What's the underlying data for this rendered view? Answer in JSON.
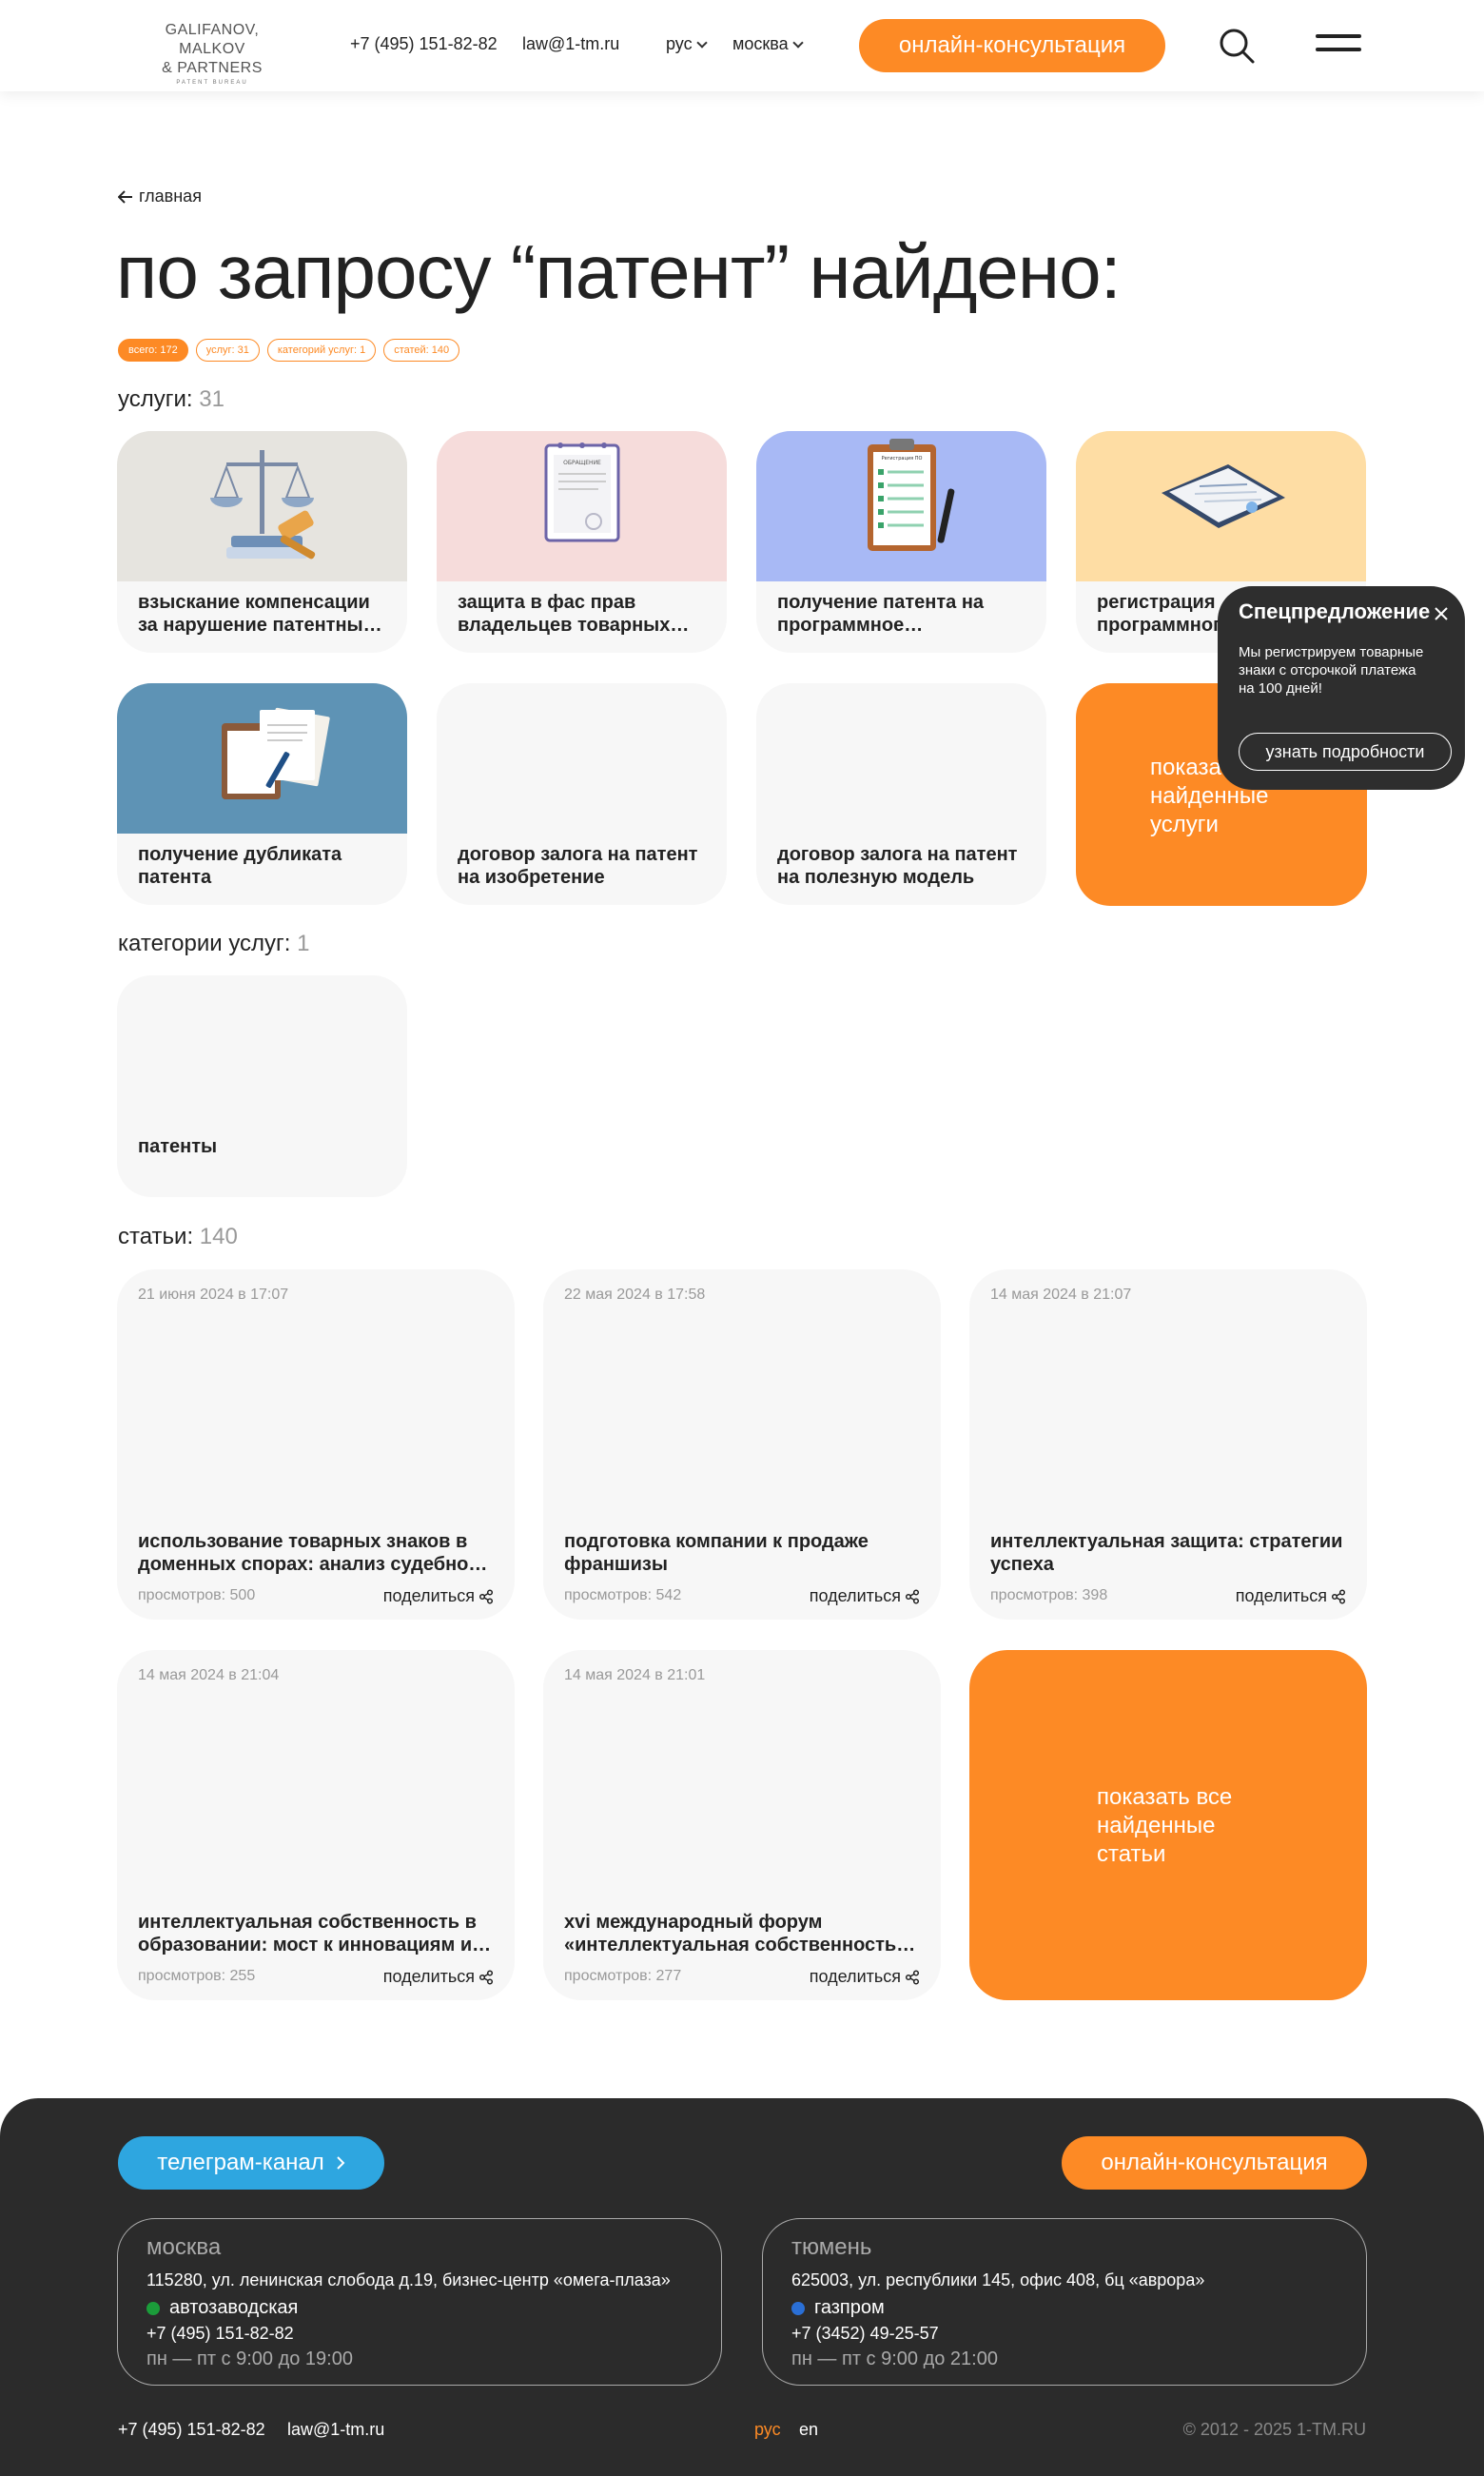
{
  "header": {
    "logo": {
      "line1": "GALIFANOV, MALKOV",
      "line2": "& PARTNERS",
      "line3": "PATENT BUREAU"
    },
    "phone": "+7 (495) 151-82-82",
    "email": "law@1-tm.ru",
    "language": "рус",
    "city": "москва",
    "cta_label": "онлайн-консультация",
    "search_icon": "search-icon",
    "menu_icon": "hamburger-menu-icon"
  },
  "breadcrumb": {
    "label": "главная"
  },
  "page": {
    "title": "по запросу “патент” найдено:",
    "chips": [
      "всего: 172",
      "услуг: 31",
      "категорий услуг: 1",
      "статей: 140"
    ]
  },
  "services": {
    "label": "услуги:",
    "count": "31",
    "items": [
      {
        "title": "взыскание компенсации за нарушение патентных прав",
        "image": "scales-gavel-illustration"
      },
      {
        "title": "защита в фас прав владельцев товарных знаков",
        "image": "document-illustration",
        "image_label": "ОБРАЩЕНИЕ"
      },
      {
        "title": "получение патента на программное обеспечение",
        "image": "clipboard-checklist-illustration",
        "image_label": "Регистрация ПО"
      },
      {
        "title": "регистрация программного обеспечения",
        "image": "certificate-illustration"
      },
      {
        "title": "получение дубликата патента",
        "image": "documents-stack-illustration"
      },
      {
        "title": "договор залога на патент на изобретение"
      },
      {
        "title": "договор залога на патент на полезную модель"
      }
    ],
    "show_all": "показать все найденные услуги"
  },
  "categories": {
    "label": "категории услуг:",
    "count": "1",
    "items": [
      {
        "title": "патенты"
      }
    ]
  },
  "articles": {
    "label": "статьи:",
    "count": "140",
    "share_label": "поделиться",
    "share_icon": "share-icon",
    "items": [
      {
        "date": "21 июня 2024 в 17:07",
        "title": "использование товарных знаков в доменных спорах: анализ судебной практики",
        "views": "просмотров: 500"
      },
      {
        "date": "22 мая 2024 в 17:58",
        "title": "подготовка компании к продаже франшизы",
        "views": "просмотров: 542"
      },
      {
        "date": "14 мая 2024 в 21:07",
        "title": "интеллектуальная защита: стратегии успеха",
        "views": "просмотров: 398"
      },
      {
        "date": "14 мая 2024 в 21:04",
        "title": "интеллектуальная собственность в образовании: мост к инновациям и развитию",
        "views": "просмотров: 255"
      },
      {
        "date": "14 мая 2024 в 21:01",
        "title": "xvi международный форум «интеллектуальная собственность – XXI век»",
        "views": "просмотров: 277"
      }
    ],
    "show_all": "показать все найденные статьи"
  },
  "popup": {
    "title": "Спецпредложение",
    "text": "Мы регистрируем товарные знаки с отсрочкой платежа на 100 дней!",
    "button": "узнать подробности"
  },
  "footer": {
    "telegram_label": "телеграм-канал",
    "cta_label": "онлайн-консультация",
    "offices": [
      {
        "city": "москва",
        "address": "115280, ул. ленинская слобода д.19, бизнес-центр «омега-плаза»",
        "metro": "автозаводская",
        "metro_color": "#1b9c3a",
        "phone": "+7 (495) 151-82-82",
        "hours": "пн — пт с 9:00 до 19:00"
      },
      {
        "city": "тюмень",
        "address": "625003, ул. республики 145, офис 408, бц «аврора»",
        "metro": "газпром",
        "metro_color": "#2a6fd6",
        "phone": "+7 (3452) 49-25-57",
        "hours": "пн — пт с 9:00 до 21:00"
      }
    ],
    "phone": "+7 (495) 151-82-82",
    "email": "law@1-tm.ru",
    "lang_ru": "рус",
    "lang_en": "en",
    "copyright": "© 2012 - 2025 1-TM.RU"
  },
  "colors": {
    "accent": "#fd8a25",
    "telegram": "#2ea6e0",
    "footer_bg": "#2b2b2b",
    "card_bg": "#f7f7f7"
  }
}
